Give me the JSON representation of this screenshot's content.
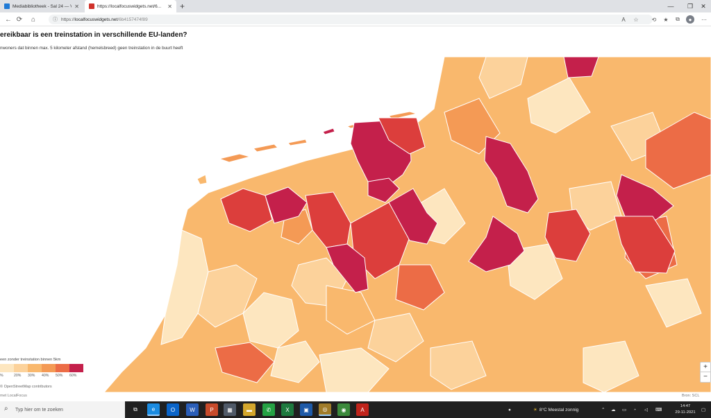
{
  "browser": {
    "tabs": [
      {
        "label": "Mediabibliotheek - Sal 24 — Vi...",
        "favicon_color": "#1f7ad6"
      },
      {
        "label": "https://localfocuswidgets.net/6...",
        "favicon_color": "#d0322b"
      }
    ],
    "new_tab": "+",
    "window_controls": {
      "minimize": "—",
      "maximize": "❐",
      "close": "✕"
    },
    "nav": {
      "back": "←",
      "reload": "⟳",
      "home": "⌂",
      "info": "ⓘ"
    },
    "url": {
      "scheme": "https://",
      "host": "localfocuswidgets.net",
      "path": "/6b4157474f89"
    },
    "toolbar_icons": [
      "read-aloud-icon",
      "add-favorite-icon",
      "refresh-icon",
      "favorites-icon",
      "collections-icon",
      "extensions-icon",
      "profile-icon",
      "more-icon"
    ]
  },
  "page": {
    "title": "ereikbaar is een treinstation in verschillende EU-landen?",
    "subtitle": "nwoners dat binnen max. 5 kilometer afstand (hemelsbreed) geen treinstation in de buurt heeft",
    "legend": {
      "title": "een zonder treinstation binnen 5km",
      "ticks": [
        "%",
        "20%",
        "30%",
        "40%",
        "50%",
        "60%"
      ],
      "colors": [
        "#fde6bf",
        "#fcd29b",
        "#f9b86d",
        "#f49a55",
        "#ec6c46",
        "#dc3e3c",
        "#c4204b"
      ]
    },
    "attribution": "© OpenStreetMap contributors",
    "brand": "met LocalFocus",
    "scale": "Bron: SCL"
  },
  "map": {
    "water_color": "#ffffff",
    "border_color": "#ffffff"
  },
  "zoom": {
    "in": "+",
    "out": "−"
  },
  "taskbar": {
    "search_placeholder": "Typ hier om te zoeken",
    "apps": [
      {
        "name": "task-view-icon",
        "glyph": "⧉",
        "color": "#202020"
      },
      {
        "name": "edge-app-icon",
        "glyph": "e",
        "color": "#1b8be0"
      },
      {
        "name": "outlook-app-icon",
        "glyph": "O",
        "color": "#0a64c8"
      },
      {
        "name": "word-app-icon",
        "glyph": "W",
        "color": "#2b5eb8"
      },
      {
        "name": "powerpoint-app-icon",
        "glyph": "P",
        "color": "#c84b2b"
      },
      {
        "name": "store-app-icon",
        "glyph": "▦",
        "color": "#505a68"
      },
      {
        "name": "explorer-app-icon",
        "glyph": "▬",
        "color": "#d4a72c"
      },
      {
        "name": "whatsapp-app-icon",
        "glyph": "✆",
        "color": "#25a244"
      },
      {
        "name": "excel-app-icon",
        "glyph": "X",
        "color": "#1d7a3f"
      },
      {
        "name": "photos-app-icon",
        "glyph": "▣",
        "color": "#1e5aa8"
      },
      {
        "name": "capture-app-icon",
        "glyph": "◎",
        "color": "#a07c2a"
      },
      {
        "name": "chrome-app-icon",
        "glyph": "◉",
        "color": "#3c8a3c"
      },
      {
        "name": "acrobat-app-icon",
        "glyph": "A",
        "color": "#c0241c"
      }
    ],
    "weather": "8°C  Meestal zonnig",
    "clock_time": "14:47",
    "clock_date": "29-11-2021"
  }
}
